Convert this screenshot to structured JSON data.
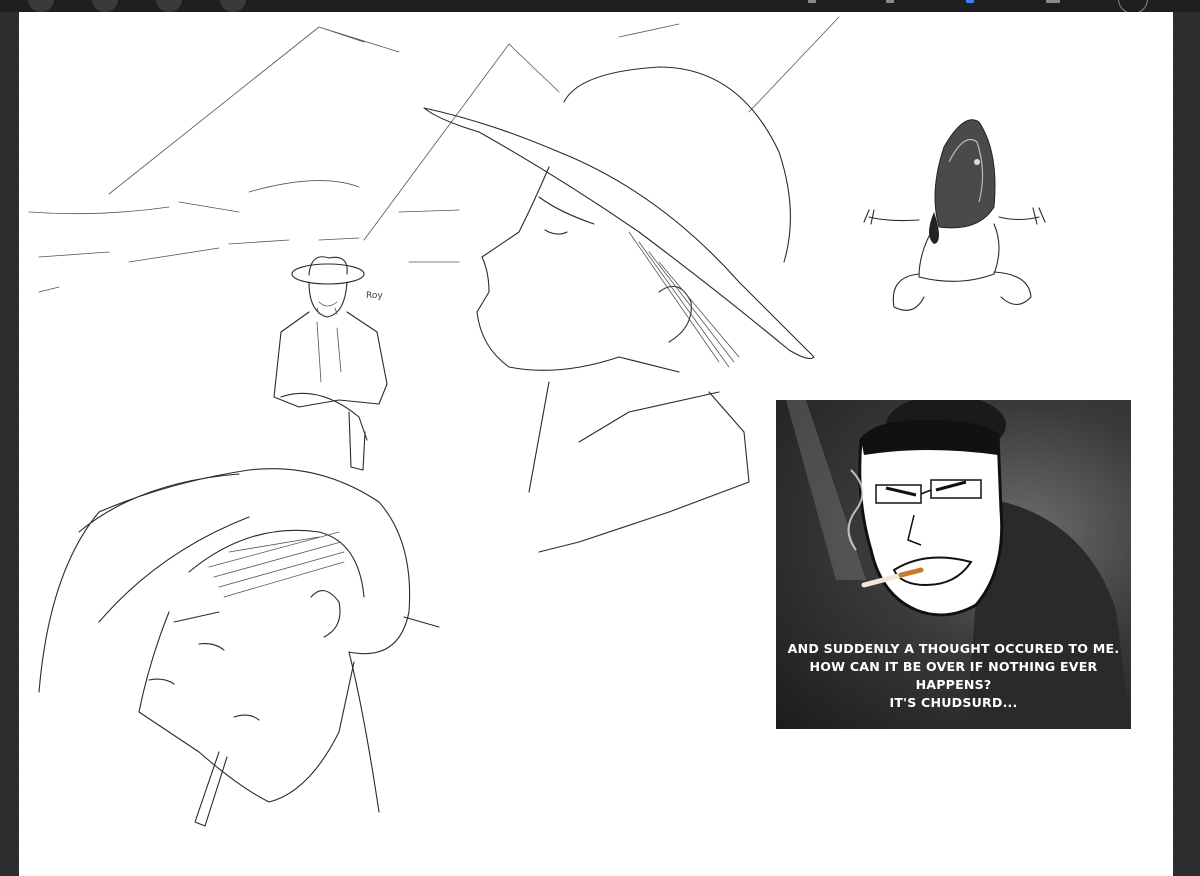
{
  "app": {
    "name": "drawing canvas"
  },
  "toolbar": {
    "tools": [
      "brush-tool",
      "smudge-tool",
      "eraser-tool",
      "layers-tool"
    ],
    "color_swatch": "#ffffff"
  },
  "canvas": {
    "background": "#ffffff",
    "sketch_label": "Roy"
  },
  "meme": {
    "caption_lines": [
      "AND SUDDENLY A THOUGHT OCCURED TO ME.",
      "HOW CAN IT BE OVER IF NOTHING EVER",
      "HAPPENS?",
      "IT'S CHUDSURD..."
    ]
  }
}
